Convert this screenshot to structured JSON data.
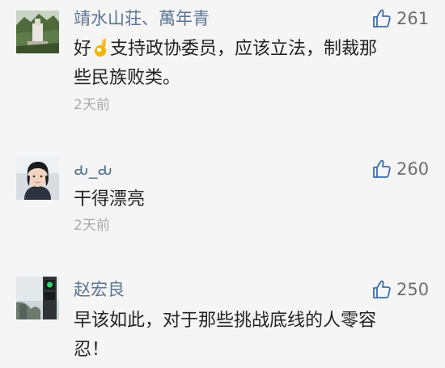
{
  "comments": [
    {
      "username": "靖水山荘、萬年青",
      "likes": "261",
      "text_lines": [
        "好",
        "支持政协委员，应该立法，制裁那",
        "些民族败类。"
      ],
      "inline_emoji": "ok-hand-emoji",
      "time": "2天前"
    },
    {
      "username": "ԃ_ԃ",
      "likes": "260",
      "text_lines": [
        "干得漂亮"
      ],
      "time": "2天前"
    },
    {
      "username": "赵宏良",
      "likes": "250",
      "text_lines": [
        "早该如此，对于那些挑战底线的人零容",
        "忍！"
      ]
    }
  ],
  "colors": {
    "background": "#f5f5f5",
    "username": "#5a7596",
    "comment_text": "#222222",
    "like_count": "#6e6e6e",
    "like_icon": "#3a6fa8",
    "timestamp": "#aaaaaa"
  },
  "icons": {
    "like": "thumbs-up-icon"
  }
}
